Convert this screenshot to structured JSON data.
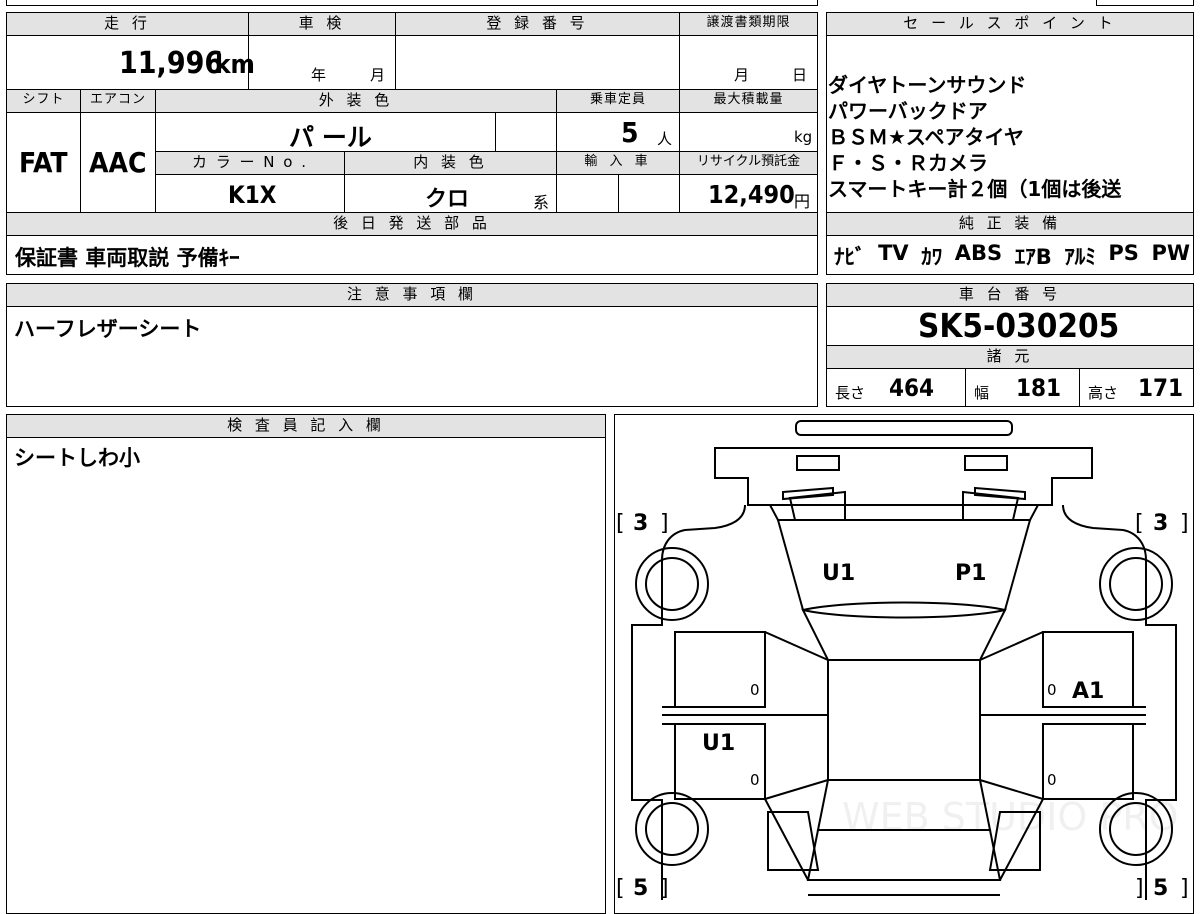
{
  "top": {
    "mileage_label": "走 行",
    "mileage_value": "11,996",
    "mileage_unit": "km",
    "inspection_label": "車 検",
    "inspection_year": "年",
    "inspection_month": "月",
    "registration_label": "登 録 番 号",
    "registration_value": "",
    "transfer_label": "譲渡書類期限",
    "transfer_month": "月",
    "transfer_day": "日",
    "shift_label": "シフト",
    "shift_value": "FAT",
    "aircon_label": "エアコン",
    "aircon_value": "AAC",
    "exterior_label": "外 装 色",
    "exterior_value": "パ ール",
    "capacity_label": "乗車定員",
    "capacity_value": "5",
    "capacity_unit": "人",
    "load_label": "最大積載量",
    "load_unit": "kg",
    "colorno_label": "カ ラ ー N o .",
    "colorno_value": "K1X",
    "interior_label": "内 装 色",
    "interior_value": "クロ",
    "interior_suffix": "系",
    "import_label": "輸 入 車",
    "recycle_label": "リサイクル預託金",
    "recycle_value": "12,490",
    "recycle_unit": "円",
    "later_parts_label": "後 日 発 送 部 品",
    "later_parts_value": "保証書 車両取説 予備ｷｰ"
  },
  "sales_points": {
    "label": "セ ー ル ス ポ イ ン ト",
    "lines": [
      "ダイヤトーンサウンド",
      "パワーバックドア",
      "ＢＳＭ★スペアタイヤ",
      "Ｆ・Ｓ・Ｒカメラ",
      "スマートキー計２個（1個は後送"
    ]
  },
  "equipment": {
    "label": "純 正 装 備",
    "items": [
      "ﾅﾋﾞ",
      "TV",
      "ｶﾜ",
      "ABS",
      "ｴｱB",
      "ｱﾙﾐ",
      "PS",
      "PW"
    ]
  },
  "notes": {
    "label": "注 意 事 項 欄",
    "value": "ハーフレザーシート"
  },
  "chassis": {
    "label": "車 台 番 号",
    "value": "SK5-030205"
  },
  "specs": {
    "label": "諸 元",
    "length_label": "長さ",
    "length_value": "464",
    "width_label": "幅",
    "width_value": "181",
    "height_label": "高さ",
    "height_value": "171"
  },
  "inspector": {
    "label": "検 査 員 記 入 欄",
    "value": "シートしわ小"
  },
  "diagram": {
    "tire_front_left": "3",
    "tire_front_right": "3",
    "tire_rear_left": "5",
    "tire_rear_right": "5",
    "mark_windshield_left": "U1",
    "mark_windshield_right": "P1",
    "mark_left_rear_door": "U1",
    "mark_right_front_door": "A1",
    "zero_label": "0",
    "watermark": "WEB STUDIO PRO"
  }
}
